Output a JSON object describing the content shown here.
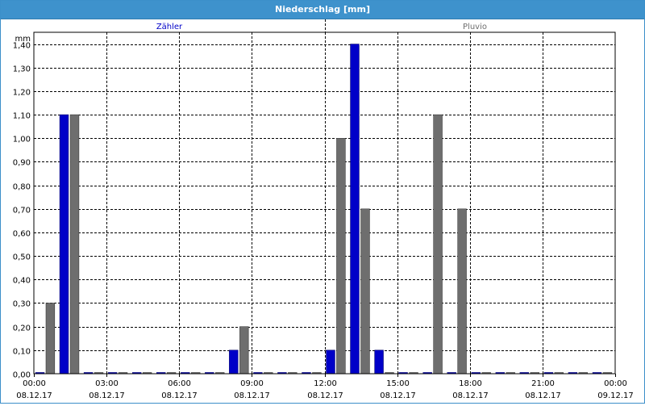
{
  "window": {
    "title": "Niederschlag [mm]"
  },
  "colors": {
    "zaehler": "#0000c8",
    "pluvio": "#6e6e6e",
    "header_bg": "#3e92cc",
    "grid": "#000000"
  },
  "chart_data": {
    "type": "bar",
    "title": "Niederschlag [mm]",
    "ylabel": "mm",
    "ylim": [
      0,
      1.45
    ],
    "y_ticks": [
      "0,00",
      "0,10",
      "0,20",
      "0,30",
      "0,40",
      "0,50",
      "0,60",
      "0,70",
      "0,80",
      "0,90",
      "1,00",
      "1,10",
      "1,20",
      "1,30",
      "1,40"
    ],
    "x_ticks": [
      {
        "time": "00:00",
        "date": "08.12.17"
      },
      {
        "time": "03:00",
        "date": "08.12.17"
      },
      {
        "time": "06:00",
        "date": "08.12.17"
      },
      {
        "time": "09:00",
        "date": "08.12.17"
      },
      {
        "time": "12:00",
        "date": "08.12.17"
      },
      {
        "time": "15:00",
        "date": "08.12.17"
      },
      {
        "time": "18:00",
        "date": "08.12.17"
      },
      {
        "time": "21:00",
        "date": "08.12.17"
      },
      {
        "time": "00:00",
        "date": "09.12.17"
      }
    ],
    "categories": [
      "00:00",
      "01:00",
      "02:00",
      "03:00",
      "04:00",
      "05:00",
      "06:00",
      "07:00",
      "08:00",
      "09:00",
      "10:00",
      "11:00",
      "12:00",
      "13:00",
      "14:00",
      "15:00",
      "16:00",
      "17:00",
      "18:00",
      "19:00",
      "20:00",
      "21:00",
      "22:00",
      "23:00"
    ],
    "series": [
      {
        "name": "Zähler",
        "values": [
          0,
          1.1,
          0,
          0,
          0,
          0,
          0,
          0,
          0.1,
          0,
          0,
          0,
          0.1,
          1.4,
          0.1,
          0,
          0,
          0,
          0,
          0,
          0,
          0,
          0,
          0
        ]
      },
      {
        "name": "Pluvio",
        "values": [
          0.3,
          1.1,
          0,
          0,
          0,
          0,
          0,
          0,
          0.2,
          0,
          0,
          0,
          1.0,
          0.7,
          0,
          0,
          1.1,
          0.7,
          0,
          0,
          0,
          0,
          0,
          0
        ]
      }
    ],
    "grid": true
  }
}
